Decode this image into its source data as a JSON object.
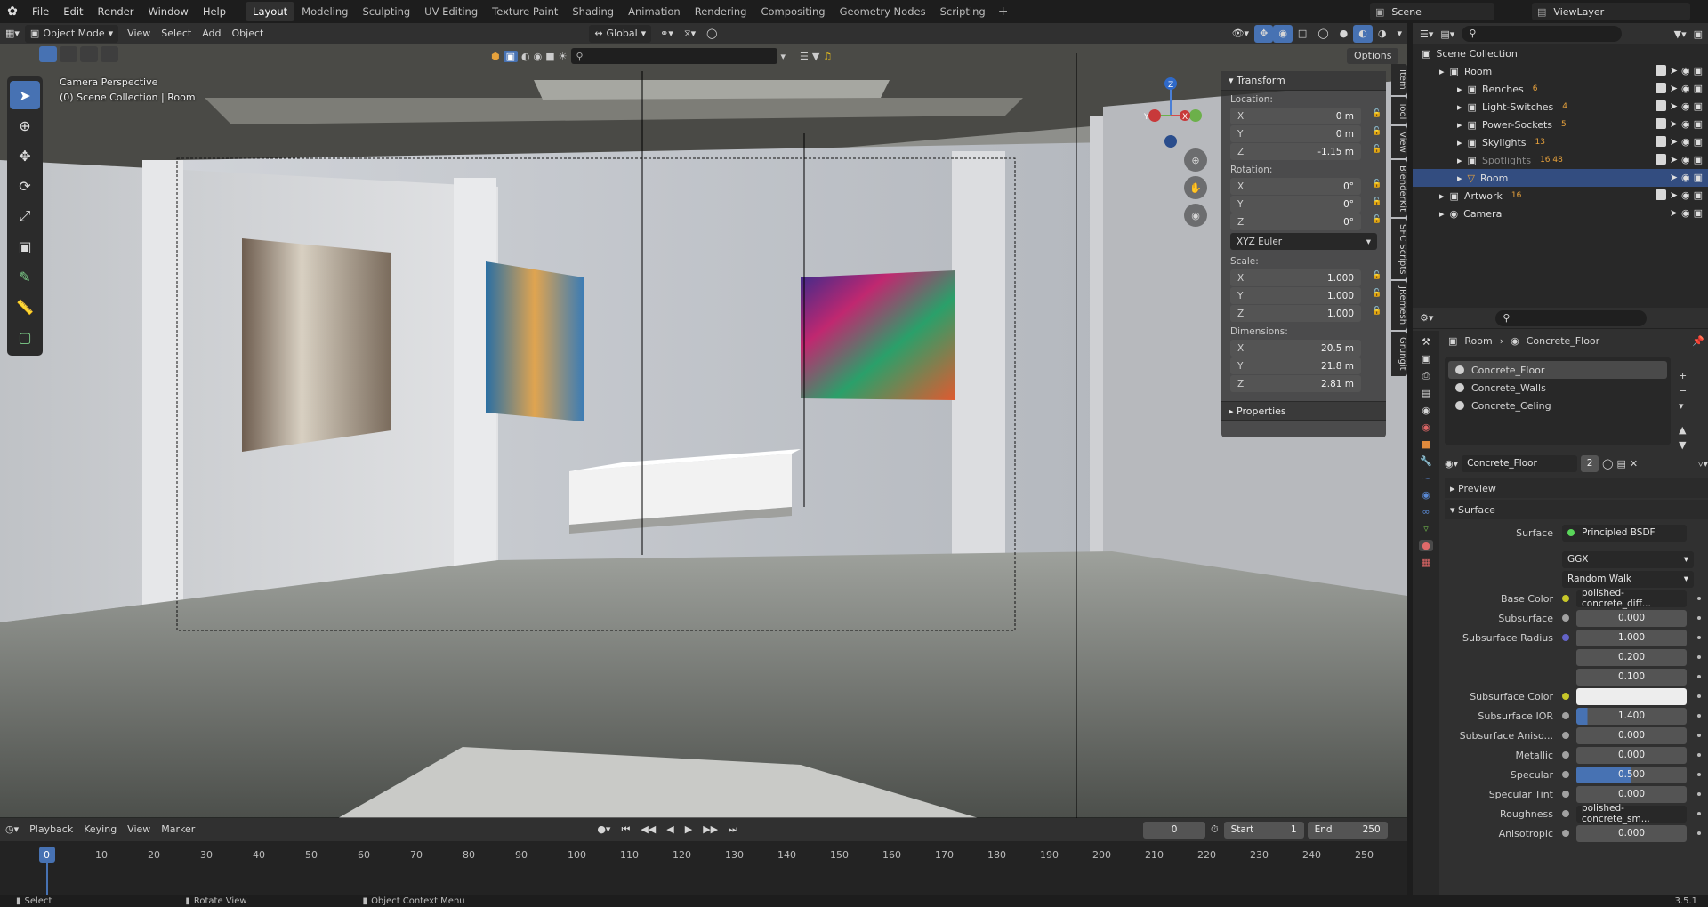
{
  "menu": [
    "File",
    "Edit",
    "Render",
    "Window",
    "Help"
  ],
  "workspaces": [
    "Layout",
    "Modeling",
    "Sculpting",
    "UV Editing",
    "Texture Paint",
    "Shading",
    "Animation",
    "Rendering",
    "Compositing",
    "Geometry Nodes",
    "Scripting"
  ],
  "active_workspace": "Layout",
  "scene_name": "Scene",
  "view_layer": "ViewLayer",
  "header3d": {
    "mode": "Object Mode",
    "menus": [
      "View",
      "Select",
      "Add",
      "Object"
    ],
    "orientation": "Global",
    "options": "Options"
  },
  "viewport": {
    "camera_label": "Camera Perspective",
    "collection_label": "(0) Scene Collection | Room",
    "gizmo": {
      "z": "Z",
      "y": "Y",
      "x": "X"
    }
  },
  "npanel": {
    "transform_title": "Transform",
    "location_label": "Location:",
    "location": [
      {
        "ax": "X",
        "val": "0 m"
      },
      {
        "ax": "Y",
        "val": "0 m"
      },
      {
        "ax": "Z",
        "val": "-1.15 m"
      }
    ],
    "rotation_label": "Rotation:",
    "rotation": [
      {
        "ax": "X",
        "val": "0°"
      },
      {
        "ax": "Y",
        "val": "0°"
      },
      {
        "ax": "Z",
        "val": "0°"
      }
    ],
    "rotation_mode": "XYZ Euler",
    "scale_label": "Scale:",
    "scale": [
      {
        "ax": "X",
        "val": "1.000"
      },
      {
        "ax": "Y",
        "val": "1.000"
      },
      {
        "ax": "Z",
        "val": "1.000"
      }
    ],
    "dimensions_label": "Dimensions:",
    "dimensions": [
      {
        "ax": "X",
        "val": "20.5 m"
      },
      {
        "ax": "Y",
        "val": "21.8 m"
      },
      {
        "ax": "Z",
        "val": "2.81 m"
      }
    ],
    "properties_title": "Properties",
    "tabs": [
      "Item",
      "Tool",
      "View",
      "BlenderKit",
      "SFC Scripts",
      "JRemesh",
      "Grungit"
    ]
  },
  "outliner": {
    "root": "Scene Collection",
    "rows": [
      {
        "label": "Room",
        "level": 1,
        "badge": ""
      },
      {
        "label": "Benches",
        "level": 2,
        "badge": "6"
      },
      {
        "label": "Light-Switches",
        "level": 2,
        "badge": "4"
      },
      {
        "label": "Power-Sockets",
        "level": 2,
        "badge": "5"
      },
      {
        "label": "Skylights",
        "level": 2,
        "badge": "13"
      },
      {
        "label": "Spotlights",
        "level": 2,
        "badge": "16 48"
      },
      {
        "label": "Room",
        "level": 2,
        "badge": ""
      },
      {
        "label": "Artwork",
        "level": 1,
        "badge": "16"
      },
      {
        "label": "Camera",
        "level": 1,
        "badge": ""
      }
    ]
  },
  "properties": {
    "breadcrumb_object": "Room",
    "breadcrumb_material": "Concrete_Floor",
    "slots": [
      "Concrete_Floor",
      "Concrete_Walls",
      "Concrete_Celing"
    ],
    "material_name": "Concrete_Floor",
    "users": "2",
    "preview": "Preview",
    "surface_section": "Surface",
    "surface_label": "Surface",
    "surface_value": "Principled BSDF",
    "dist": "GGX",
    "sss_method": "Random Walk",
    "rows": [
      {
        "label": "Base Color",
        "value": "polished-concrete_diff...",
        "kind": "link",
        "sock": "#c7c729"
      },
      {
        "label": "Subsurface",
        "value": "0.000",
        "kind": "num",
        "sock": "#a1a1a1"
      },
      {
        "label": "Subsurface Radius",
        "value": "1.000",
        "kind": "num",
        "sock": "#6363c7"
      },
      {
        "label": "",
        "value": "0.200",
        "kind": "num",
        "sock": ""
      },
      {
        "label": "",
        "value": "0.100",
        "kind": "num",
        "sock": ""
      },
      {
        "label": "Subsurface Color",
        "value": "",
        "kind": "color",
        "sock": "#c7c729"
      },
      {
        "label": "Subsurface IOR",
        "value": "1.400",
        "kind": "num",
        "sock": "#a1a1a1"
      },
      {
        "label": "Subsurface Aniso...",
        "value": "0.000",
        "kind": "num",
        "sock": "#a1a1a1"
      },
      {
        "label": "Metallic",
        "value": "0.000",
        "kind": "num",
        "sock": "#a1a1a1"
      },
      {
        "label": "Specular",
        "value": "0.500",
        "kind": "num",
        "sock": "#a1a1a1"
      },
      {
        "label": "Specular Tint",
        "value": "0.000",
        "kind": "num",
        "sock": "#a1a1a1"
      },
      {
        "label": "Roughness",
        "value": "polished-concrete_sm...",
        "kind": "link",
        "sock": "#a1a1a1"
      },
      {
        "label": "Anisotropic",
        "value": "0.000",
        "kind": "num",
        "sock": "#a1a1a1"
      }
    ]
  },
  "timeline": {
    "menus": [
      "Playback",
      "Keying",
      "View",
      "Marker"
    ],
    "current_frame": "0",
    "start_label": "Start",
    "start": "1",
    "end_label": "End",
    "end": "250",
    "ticks": [
      "0",
      "10",
      "20",
      "30",
      "40",
      "50",
      "60",
      "70",
      "80",
      "90",
      "100",
      "110",
      "120",
      "130",
      "140",
      "150",
      "160",
      "170",
      "180",
      "190",
      "200",
      "210",
      "220",
      "230",
      "240",
      "250"
    ]
  },
  "status": {
    "select": "Select",
    "rotate": "Rotate View",
    "context": "Object Context Menu",
    "version": "3.5.1"
  }
}
